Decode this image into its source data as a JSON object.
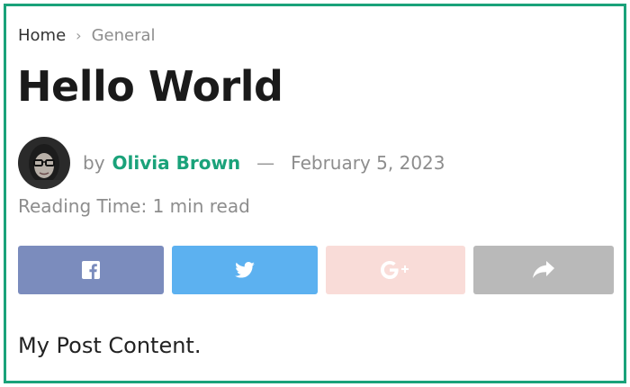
{
  "breadcrumb": {
    "home": "Home",
    "separator": "›",
    "current": "General"
  },
  "post": {
    "title": "Hello World",
    "by_label": "by",
    "author": "Olivia Brown",
    "dash": "—",
    "date": "February 5, 2023",
    "reading_time": "Reading Time: 1 min read",
    "content": "My Post Content."
  },
  "share": {
    "buttons": [
      {
        "network": "facebook",
        "icon": "facebook-icon",
        "color": "#7b8cbd"
      },
      {
        "network": "twitter",
        "icon": "twitter-icon",
        "color": "#5cb1f0"
      },
      {
        "network": "google-plus",
        "icon": "google-plus-icon",
        "color": "#f9dcd8"
      },
      {
        "network": "share",
        "icon": "share-arrow-icon",
        "color": "#b9b9b9"
      }
    ]
  },
  "colors": {
    "accent": "#1aa27a",
    "frame": "#1aa27a",
    "muted_text": "#8d8d8d"
  }
}
